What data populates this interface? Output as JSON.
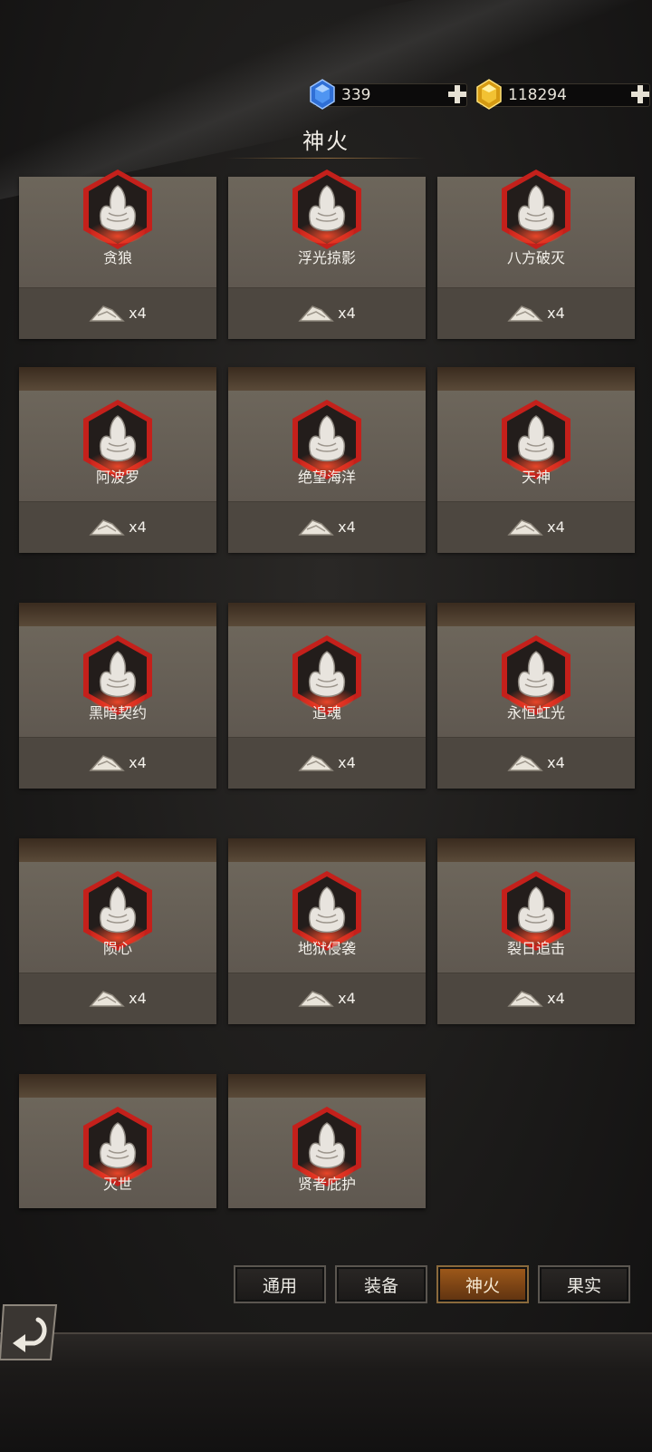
{
  "currency": {
    "diamond": "339",
    "gold": "118294"
  },
  "title": "神火",
  "cards": [
    {
      "name": "贪狼",
      "cost": "x4"
    },
    {
      "name": "浮光掠影",
      "cost": "x4"
    },
    {
      "name": "八方破灭",
      "cost": "x4"
    },
    {
      "name": "阿波罗",
      "cost": "x4"
    },
    {
      "name": "绝望海洋",
      "cost": "x4"
    },
    {
      "name": "天神",
      "cost": "x4"
    },
    {
      "name": "黑暗契约",
      "cost": "x4"
    },
    {
      "name": "追魂",
      "cost": "x4"
    },
    {
      "name": "永恒虹光",
      "cost": "x4"
    },
    {
      "name": "陨心",
      "cost": "x4"
    },
    {
      "name": "地狱侵袭",
      "cost": "x4"
    },
    {
      "name": "裂日追击",
      "cost": "x4"
    },
    {
      "name": "灭世",
      "cost": ""
    },
    {
      "name": "贤者庇护",
      "cost": ""
    }
  ],
  "tabs": [
    {
      "label": "通用"
    },
    {
      "label": "装备"
    },
    {
      "label": "神火",
      "active": true
    },
    {
      "label": "果实"
    }
  ],
  "colors": {
    "accent_red": "#c0201c",
    "active_tab": "#a05a1a"
  }
}
